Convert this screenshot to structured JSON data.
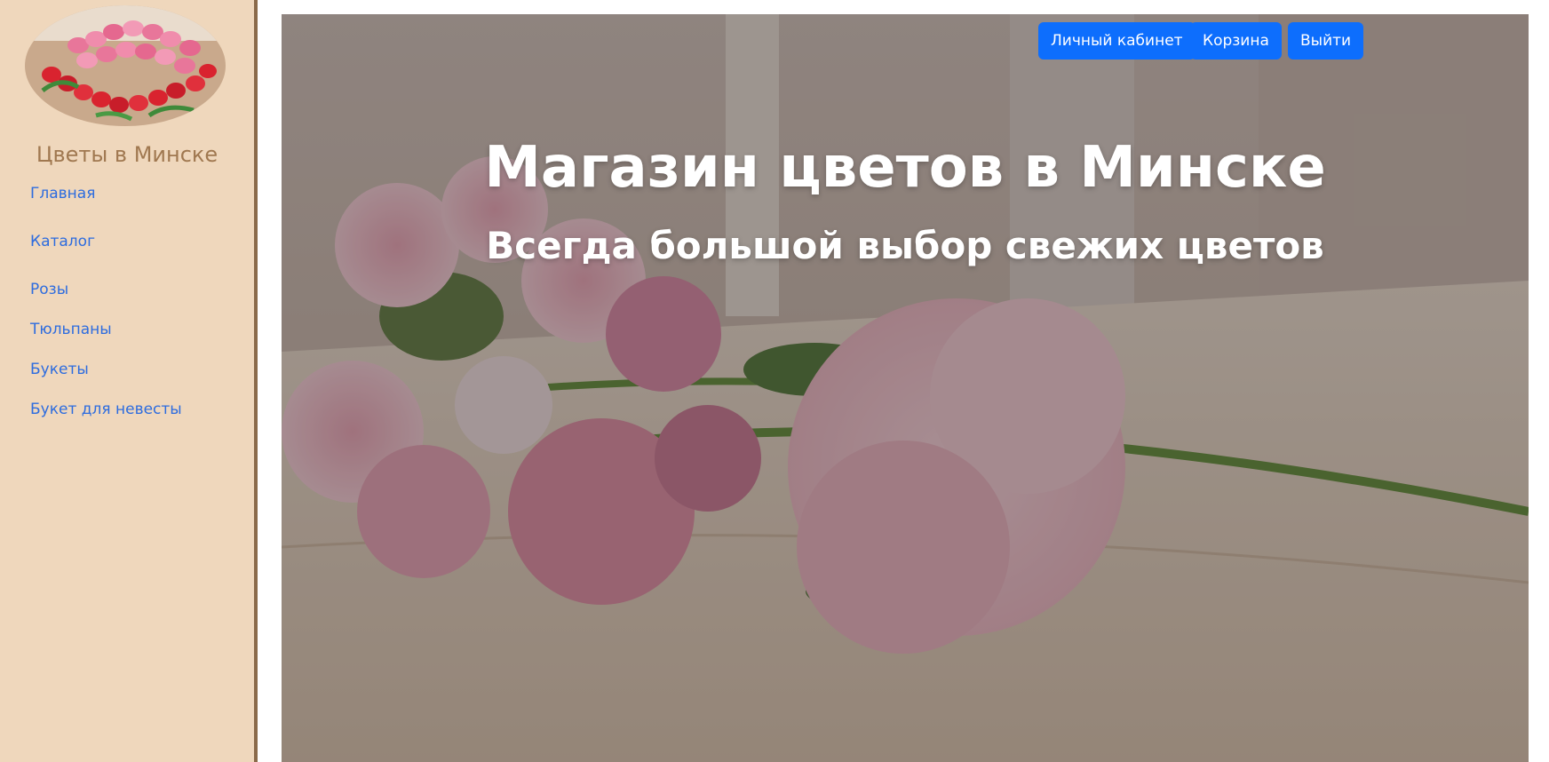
{
  "sidebar": {
    "logo": "tulips-bouquet-image",
    "site_name": "Цветы в Минске",
    "nav": [
      {
        "label": "Главная"
      },
      {
        "label": "Каталог"
      },
      {
        "label": "Розы"
      },
      {
        "label": "Тюльпаны"
      },
      {
        "label": "Букеты"
      },
      {
        "label": "Букет для невесты"
      }
    ]
  },
  "header": {
    "account_label": "Личный кабинет",
    "cart_label": "Корзина",
    "logout_label": "Выйти"
  },
  "hero": {
    "title": "Магазин цветов в Минске",
    "subtitle": "Всегда большой выбор свежих цветов",
    "image": "pink-peonies-hydrangea-on-table"
  },
  "colors": {
    "sidebar_bg": "#efd7bc",
    "site_name": "#a07850",
    "link": "#2d6cdf",
    "button": "#0d6efd"
  }
}
